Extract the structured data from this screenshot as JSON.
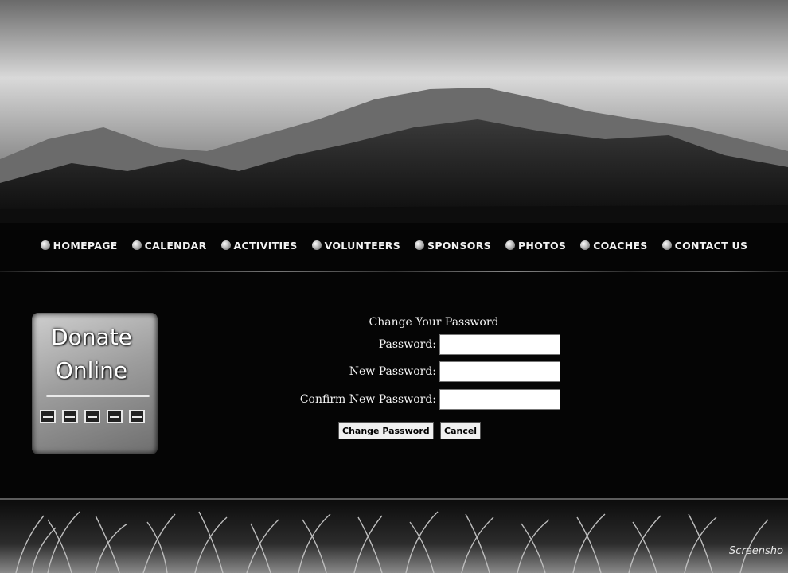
{
  "nav": {
    "items": [
      {
        "label": "HOMEPAGE"
      },
      {
        "label": "CALENDAR"
      },
      {
        "label": "ACTIVITIES"
      },
      {
        "label": "VOLUNTEERS"
      },
      {
        "label": "SPONSORS"
      },
      {
        "label": "PHOTOS"
      },
      {
        "label": "COACHES"
      },
      {
        "label": "CONTACT US"
      }
    ]
  },
  "donate": {
    "line1": "Donate",
    "line2": "Online",
    "icons": [
      "credit-card-icon",
      "credit-card-icon",
      "credit-card-icon",
      "credit-card-icon",
      "credit-card-icon"
    ]
  },
  "form": {
    "title": "Change Your Password",
    "password_label": "Password:",
    "password_value": "",
    "new_password_label": "New Password:",
    "new_password_value": "",
    "confirm_label": "Confirm New Password:",
    "confirm_value": "",
    "submit_label": "Change Password",
    "cancel_label": "Cancel"
  },
  "footer": {
    "watermark": "Screensho"
  },
  "colors": {
    "background": "#050505",
    "text": "#f4f4f4",
    "input_bg": "#ffffff"
  }
}
